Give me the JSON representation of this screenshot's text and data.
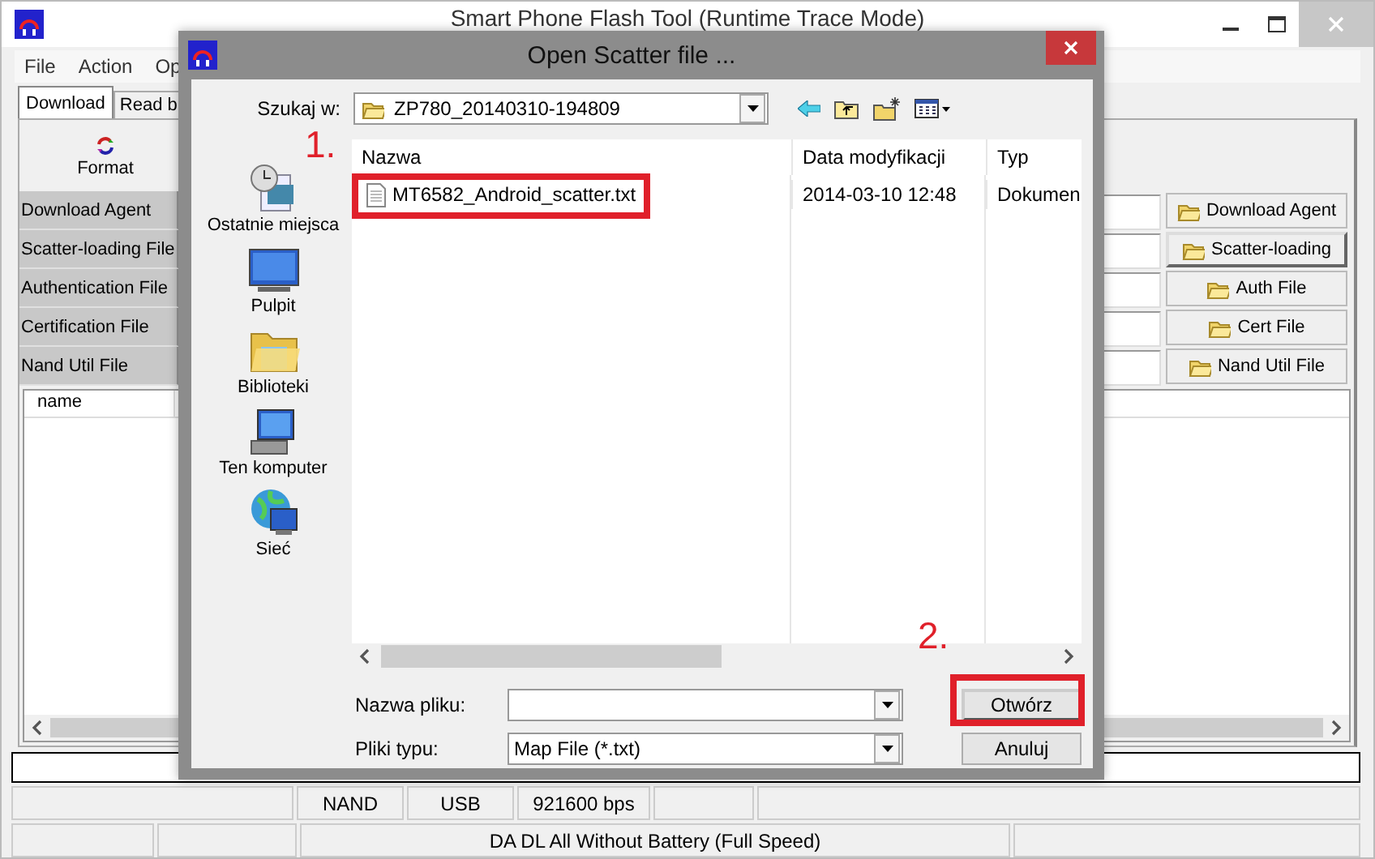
{
  "app_window": {
    "title": "Smart Phone Flash Tool (Runtime Trace Mode)",
    "menu": [
      "File",
      "Action",
      "Op"
    ],
    "tabs": [
      {
        "label": "Download",
        "selected": true
      },
      {
        "label": "Read b",
        "selected": false
      }
    ],
    "toolbar": [
      {
        "label": "Format"
      }
    ],
    "file_rows": [
      {
        "label": "Download Agent",
        "button": "Download Agent",
        "focused": false
      },
      {
        "label": "Scatter-loading File",
        "button": "Scatter-loading",
        "focused": true
      },
      {
        "label": "Authentication File",
        "button": "Auth File",
        "focused": false
      },
      {
        "label": "Certification File",
        "button": "Cert File",
        "focused": false
      },
      {
        "label": "Nand Util File",
        "button": "Nand Util File",
        "focused": false
      }
    ],
    "list": {
      "columns": [
        "name"
      ]
    },
    "status_bar": {
      "row_1": [
        "NAND",
        "USB",
        "921600 bps"
      ],
      "row_2": [
        "DA DL All Without Battery (Full Speed)"
      ]
    }
  },
  "dialog": {
    "title": "Open Scatter file ...",
    "look_in_label": "Szukaj w:",
    "look_in_value": "ZP780_20140310-194809",
    "places": [
      {
        "label": "Ostatnie miejsca",
        "kind": "recent"
      },
      {
        "label": "Pulpit",
        "kind": "desktop"
      },
      {
        "label": "Biblioteki",
        "kind": "libraries"
      },
      {
        "label": "Ten komputer",
        "kind": "computer"
      },
      {
        "label": "Sieć",
        "kind": "network"
      }
    ],
    "columns": [
      "Nazwa",
      "Data modyfikacji",
      "Typ"
    ],
    "files": [
      {
        "name": "MT6582_Android_scatter.txt",
        "modified": "2014-03-10 12:48",
        "type": "Dokumen"
      }
    ],
    "file_name_label": "Nazwa pliku:",
    "file_type_label": "Pliki typu:",
    "file_type_value": "Map File (*.txt)",
    "buttons": [
      {
        "label": "Otwórz",
        "focused": true
      },
      {
        "label": "Anuluj",
        "focused": false
      }
    ]
  },
  "annotations": [
    {
      "label": "1."
    },
    {
      "label": "2."
    }
  ]
}
